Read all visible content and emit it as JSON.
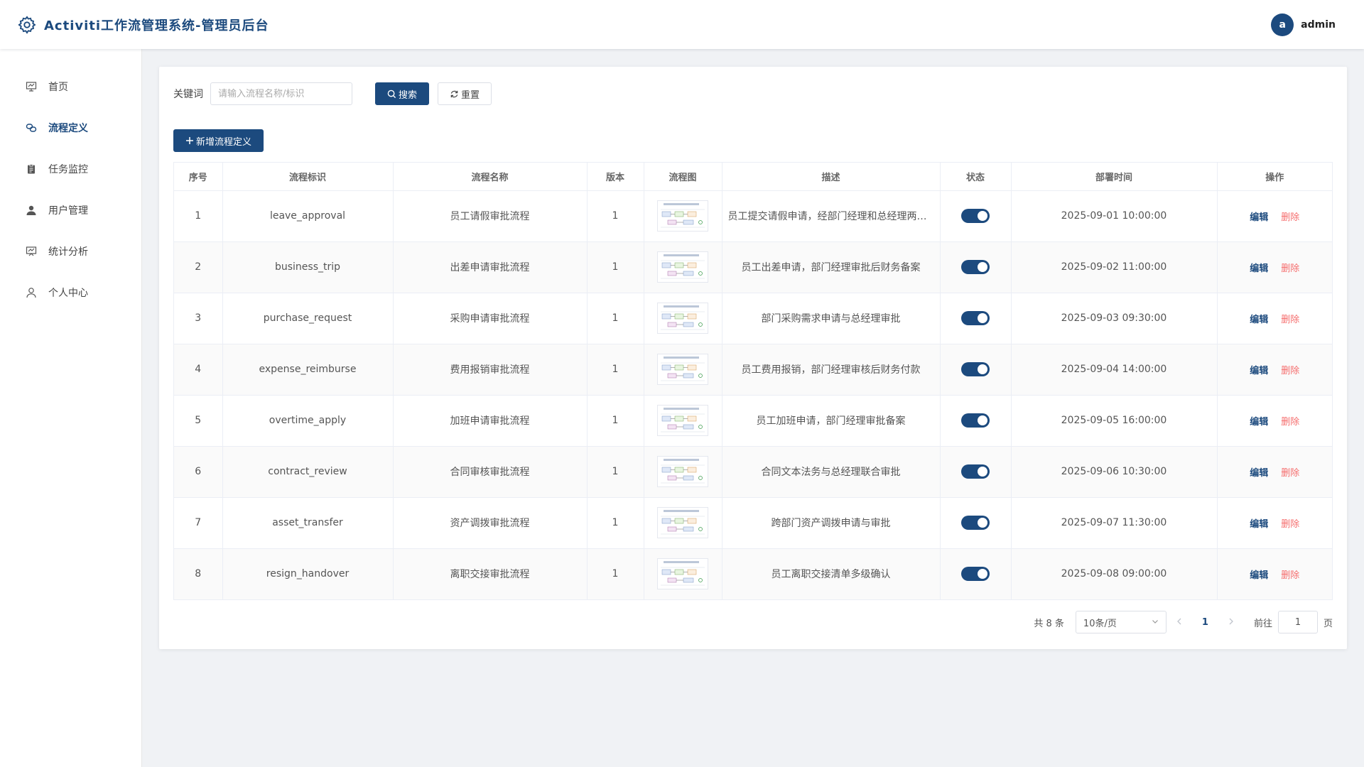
{
  "header": {
    "title": "Activiti工作流管理系统-管理员后台",
    "avatar_letter": "a",
    "username": "admin"
  },
  "sidebar": {
    "items": [
      {
        "label": "首页",
        "icon": "presentation-icon",
        "active": false
      },
      {
        "label": "流程定义",
        "icon": "link-icon",
        "active": true
      },
      {
        "label": "任务监控",
        "icon": "clipboard-icon",
        "active": false
      },
      {
        "label": "用户管理",
        "icon": "user-filled-icon",
        "active": false
      },
      {
        "label": "统计分析",
        "icon": "chart-board-icon",
        "active": false
      },
      {
        "label": "个人中心",
        "icon": "user-outline-icon",
        "active": false
      }
    ]
  },
  "search": {
    "label": "关键词",
    "placeholder": "请输入流程名称/标识",
    "search_button": "搜索",
    "reset_button": "重置"
  },
  "toolbar": {
    "add_button": "新增流程定义"
  },
  "table": {
    "columns": [
      "序号",
      "流程标识",
      "流程名称",
      "版本",
      "流程图",
      "描述",
      "状态",
      "部署时间",
      "操作"
    ],
    "edit_label": "编辑",
    "delete_label": "删除",
    "rows": [
      {
        "no": "1",
        "key": "leave_approval",
        "name": "员工请假审批流程",
        "version": "1",
        "desc": "员工提交请假申请，经部门经理和总经理两级审批",
        "enabled": true,
        "deploy_time": "2025-09-01 10:00:00"
      },
      {
        "no": "2",
        "key": "business_trip",
        "name": "出差申请审批流程",
        "version": "1",
        "desc": "员工出差申请，部门经理审批后财务备案",
        "enabled": true,
        "deploy_time": "2025-09-02 11:00:00"
      },
      {
        "no": "3",
        "key": "purchase_request",
        "name": "采购申请审批流程",
        "version": "1",
        "desc": "部门采购需求申请与总经理审批",
        "enabled": true,
        "deploy_time": "2025-09-03 09:30:00"
      },
      {
        "no": "4",
        "key": "expense_reimburse",
        "name": "费用报销审批流程",
        "version": "1",
        "desc": "员工费用报销，部门经理审核后财务付款",
        "enabled": true,
        "deploy_time": "2025-09-04 14:00:00"
      },
      {
        "no": "5",
        "key": "overtime_apply",
        "name": "加班申请审批流程",
        "version": "1",
        "desc": "员工加班申请，部门经理审批备案",
        "enabled": true,
        "deploy_time": "2025-09-05 16:00:00"
      },
      {
        "no": "6",
        "key": "contract_review",
        "name": "合同审核审批流程",
        "version": "1",
        "desc": "合同文本法务与总经理联合审批",
        "enabled": true,
        "deploy_time": "2025-09-06 10:30:00"
      },
      {
        "no": "7",
        "key": "asset_transfer",
        "name": "资产调拨审批流程",
        "version": "1",
        "desc": "跨部门资产调拨申请与审批",
        "enabled": true,
        "deploy_time": "2025-09-07 11:30:00"
      },
      {
        "no": "8",
        "key": "resign_handover",
        "name": "离职交接审批流程",
        "version": "1",
        "desc": "员工离职交接清单多级确认",
        "enabled": true,
        "deploy_time": "2025-09-08 09:00:00"
      }
    ]
  },
  "pagination": {
    "total_text": "共 8 条",
    "page_size": "10条/页",
    "current_page": "1",
    "goto_label": "前往",
    "goto_value": "1",
    "page_unit": "页"
  },
  "colors": {
    "primary": "#1c4a7e",
    "danger": "#f56c6c",
    "background": "#f0f2f5"
  }
}
